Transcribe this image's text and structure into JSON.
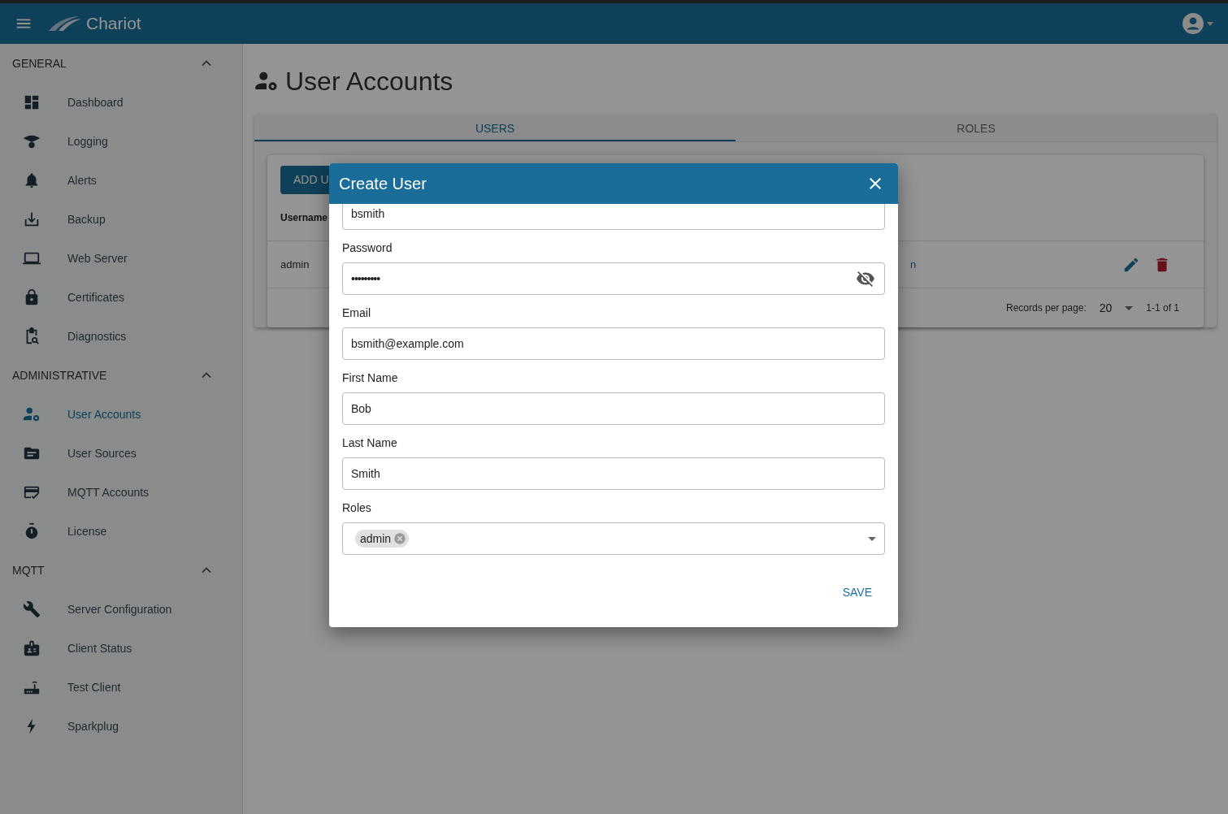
{
  "app": {
    "title": "Chariot"
  },
  "sidebar": {
    "sections": [
      {
        "title": "GENERAL",
        "expanded": true,
        "items": [
          {
            "label": "Dashboard",
            "selected": false
          },
          {
            "label": "Logging",
            "selected": false
          },
          {
            "label": "Alerts",
            "selected": false
          },
          {
            "label": "Backup",
            "selected": false
          },
          {
            "label": "Web Server",
            "selected": false
          },
          {
            "label": "Certificates",
            "selected": false
          },
          {
            "label": "Diagnostics",
            "selected": false
          }
        ]
      },
      {
        "title": "ADMINISTRATIVE",
        "expanded": true,
        "items": [
          {
            "label": "User Accounts",
            "selected": true
          },
          {
            "label": "User Sources",
            "selected": false
          },
          {
            "label": "MQTT Accounts",
            "selected": false
          },
          {
            "label": "License",
            "selected": false
          }
        ]
      },
      {
        "title": "MQTT",
        "expanded": true,
        "items": [
          {
            "label": "Server Configuration",
            "selected": false
          },
          {
            "label": "Client Status",
            "selected": false
          },
          {
            "label": "Test Client",
            "selected": false
          },
          {
            "label": "Sparkplug",
            "selected": false
          }
        ]
      }
    ]
  },
  "page": {
    "title": "User Accounts",
    "tabs": [
      {
        "label": "USERS",
        "selected": true
      },
      {
        "label": "ROLES",
        "selected": false
      }
    ],
    "add_button": "ADD U",
    "table": {
      "columns": [
        "Username"
      ],
      "rows": [
        {
          "cells": [
            "admin",
            "n"
          ]
        }
      ]
    },
    "footer": {
      "records_label": "Records per page:",
      "per_page": "20",
      "range": "1-1 of 1"
    }
  },
  "dialog": {
    "title": "Create User",
    "fields": [
      {
        "kind": "text",
        "value": "bsmith"
      },
      {
        "kind": "password",
        "label": "Password",
        "value": "•••••••••"
      },
      {
        "kind": "text",
        "label": "Email",
        "value": "bsmith@example.com"
      },
      {
        "kind": "text",
        "label": "First Name",
        "value": "Bob"
      },
      {
        "kind": "text",
        "label": "Last Name",
        "value": "Smith"
      },
      {
        "kind": "chips",
        "label": "Roles",
        "chips": [
          "admin"
        ]
      }
    ],
    "save": "SAVE"
  }
}
